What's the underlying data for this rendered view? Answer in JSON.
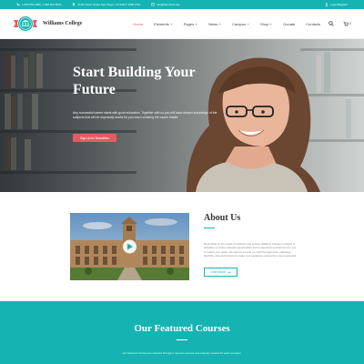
{
  "topbar": {
    "phone": "1 800 559 6580, 1 800 603 6035",
    "address": "2130 Fulton Street San Diego, CA 94117-1080 USA",
    "email": "info@demolink.org",
    "login": "Login/Register",
    "icons": [
      "phone-icon",
      "location-icon",
      "mail-icon",
      "user-icon"
    ]
  },
  "header": {
    "logo_text": "Williams College",
    "nav": [
      {
        "label": "Home",
        "active": true,
        "caret": false
      },
      {
        "label": "Elements",
        "active": false,
        "caret": true
      },
      {
        "label": "Pages",
        "active": false,
        "caret": true
      },
      {
        "label": "News",
        "active": false,
        "caret": true
      },
      {
        "label": "Campus",
        "active": false,
        "caret": true
      },
      {
        "label": "Shop",
        "active": false,
        "caret": true
      },
      {
        "label": "Donate",
        "active": false,
        "caret": false
      },
      {
        "label": "Contacts",
        "active": false,
        "caret": false
      }
    ],
    "cart_count": "0"
  },
  "hero": {
    "title": "Start Building Your Future",
    "text": "Any successful career starts with good education. Together with us you will have deeper knowledge of the subjects that will be especially useful for you when climbing the career ladder.",
    "button": "Sign Up for Newsletter"
  },
  "about": {
    "title": "About Us",
    "text": "Depending on the needs of students and society, Williams College's mission in education provides relevant opportunities and a supportive environment for you to realize your goals. We want to provide you with the right tools, pathways, flexibility, and environment to make your academic experience more successful.",
    "button": "Learn More"
  },
  "featured": {
    "title": "Our Featured Courses",
    "text": "Our featured courses are selected through a rigorous process and uniquely created for each semester."
  },
  "colors": {
    "teal": "#16b3b3",
    "accent": "#e45b63"
  }
}
